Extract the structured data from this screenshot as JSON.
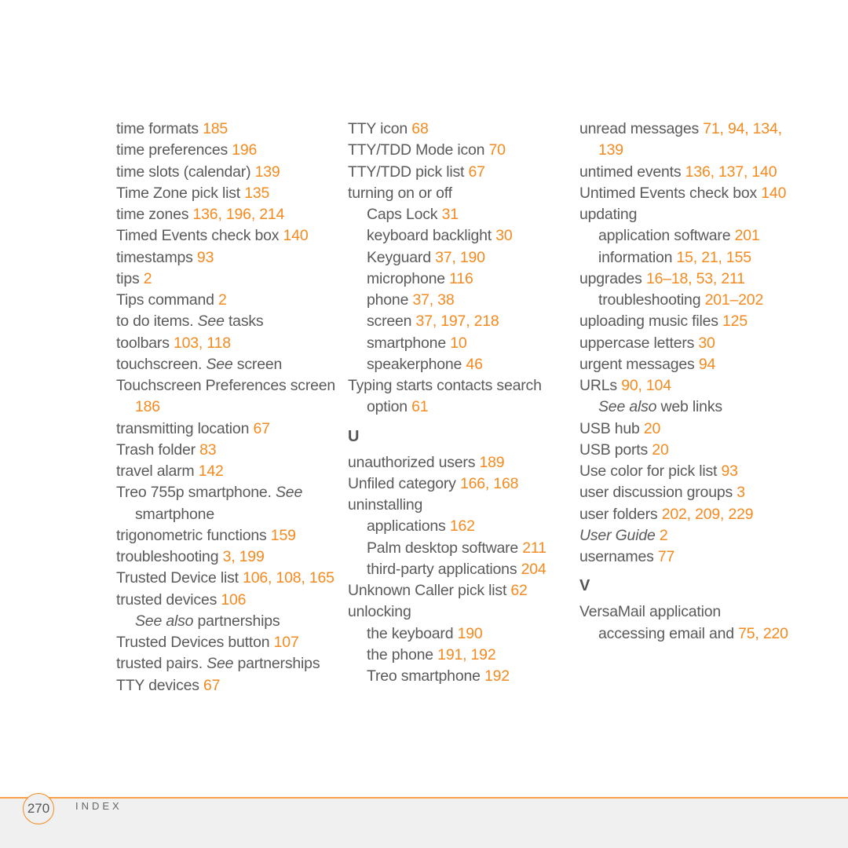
{
  "accent_color": "#f58a1f",
  "columns": [
    {
      "entries": [
        {
          "level": 0,
          "parts": [
            {
              "t": "time formats "
            },
            {
              "t": "185",
              "pg": true
            }
          ]
        },
        {
          "level": 0,
          "parts": [
            {
              "t": "time preferences "
            },
            {
              "t": "196",
              "pg": true
            }
          ]
        },
        {
          "level": 0,
          "parts": [
            {
              "t": "time slots (calendar) "
            },
            {
              "t": "139",
              "pg": true
            }
          ]
        },
        {
          "level": 0,
          "parts": [
            {
              "t": "Time Zone pick list "
            },
            {
              "t": "135",
              "pg": true
            }
          ]
        },
        {
          "level": 0,
          "parts": [
            {
              "t": "time zones "
            },
            {
              "t": "136, 196, 214",
              "pg": true
            }
          ]
        },
        {
          "level": 0,
          "parts": [
            {
              "t": "Timed Events check box "
            },
            {
              "t": "140",
              "pg": true
            }
          ]
        },
        {
          "level": 0,
          "parts": [
            {
              "t": "timestamps "
            },
            {
              "t": "93",
              "pg": true
            }
          ]
        },
        {
          "level": 0,
          "parts": [
            {
              "t": "tips "
            },
            {
              "t": "2",
              "pg": true
            }
          ]
        },
        {
          "level": 0,
          "parts": [
            {
              "t": "Tips command "
            },
            {
              "t": "2",
              "pg": true
            }
          ]
        },
        {
          "level": 0,
          "parts": [
            {
              "t": "to do items. "
            },
            {
              "t": "See",
              "it": true
            },
            {
              "t": " tasks"
            }
          ]
        },
        {
          "level": 0,
          "parts": [
            {
              "t": "toolbars "
            },
            {
              "t": "103, 118",
              "pg": true
            }
          ]
        },
        {
          "level": 0,
          "parts": [
            {
              "t": "touchscreen. "
            },
            {
              "t": "See",
              "it": true
            },
            {
              "t": " screen"
            }
          ]
        },
        {
          "level": 0,
          "parts": [
            {
              "t": "Touchscreen Preferences screen "
            },
            {
              "t": "186",
              "pg": true
            }
          ]
        },
        {
          "level": 0,
          "parts": [
            {
              "t": "transmitting location "
            },
            {
              "t": "67",
              "pg": true
            }
          ]
        },
        {
          "level": 0,
          "parts": [
            {
              "t": "Trash folder "
            },
            {
              "t": "83",
              "pg": true
            }
          ]
        },
        {
          "level": 0,
          "parts": [
            {
              "t": "travel alarm "
            },
            {
              "t": "142",
              "pg": true
            }
          ]
        },
        {
          "level": 0,
          "parts": [
            {
              "t": "Treo 755p smartphone. "
            },
            {
              "t": "See",
              "it": true
            },
            {
              "t": " smartphone"
            }
          ]
        },
        {
          "level": 0,
          "parts": [
            {
              "t": "trigonometric functions "
            },
            {
              "t": "159",
              "pg": true
            }
          ]
        },
        {
          "level": 0,
          "parts": [
            {
              "t": "troubleshooting "
            },
            {
              "t": "3, 199",
              "pg": true
            }
          ]
        },
        {
          "level": 0,
          "parts": [
            {
              "t": "Trusted Device list "
            },
            {
              "t": "106, 108, 165",
              "pg": true
            }
          ]
        },
        {
          "level": 0,
          "parts": [
            {
              "t": "trusted devices "
            },
            {
              "t": "106",
              "pg": true
            }
          ]
        },
        {
          "level": 1,
          "parts": [
            {
              "t": "See also",
              "it": true
            },
            {
              "t": " partnerships"
            }
          ]
        },
        {
          "level": 0,
          "parts": [
            {
              "t": "Trusted Devices button "
            },
            {
              "t": "107",
              "pg": true
            }
          ]
        },
        {
          "level": 0,
          "parts": [
            {
              "t": "trusted pairs. "
            },
            {
              "t": "See",
              "it": true
            },
            {
              "t": " partnerships"
            }
          ]
        },
        {
          "level": 0,
          "parts": [
            {
              "t": "TTY devices "
            },
            {
              "t": "67",
              "pg": true
            }
          ]
        }
      ]
    },
    {
      "entries": [
        {
          "level": 0,
          "parts": [
            {
              "t": "TTY icon "
            },
            {
              "t": "68",
              "pg": true
            }
          ]
        },
        {
          "level": 0,
          "parts": [
            {
              "t": "TTY/TDD Mode icon "
            },
            {
              "t": "70",
              "pg": true
            }
          ]
        },
        {
          "level": 0,
          "parts": [
            {
              "t": "TTY/TDD pick list "
            },
            {
              "t": "67",
              "pg": true
            }
          ]
        },
        {
          "level": 0,
          "parts": [
            {
              "t": "turning on or off"
            }
          ]
        },
        {
          "level": 1,
          "parts": [
            {
              "t": "Caps Lock "
            },
            {
              "t": "31",
              "pg": true
            }
          ]
        },
        {
          "level": 1,
          "parts": [
            {
              "t": "keyboard backlight "
            },
            {
              "t": "30",
              "pg": true
            }
          ]
        },
        {
          "level": 1,
          "parts": [
            {
              "t": "Keyguard "
            },
            {
              "t": "37, 190",
              "pg": true
            }
          ]
        },
        {
          "level": 1,
          "parts": [
            {
              "t": "microphone "
            },
            {
              "t": "116",
              "pg": true
            }
          ]
        },
        {
          "level": 1,
          "parts": [
            {
              "t": "phone "
            },
            {
              "t": "37, 38",
              "pg": true
            }
          ]
        },
        {
          "level": 1,
          "parts": [
            {
              "t": "screen "
            },
            {
              "t": "37, 197, 218",
              "pg": true
            }
          ]
        },
        {
          "level": 1,
          "parts": [
            {
              "t": "smartphone "
            },
            {
              "t": "10",
              "pg": true
            }
          ]
        },
        {
          "level": 1,
          "parts": [
            {
              "t": "speakerphone "
            },
            {
              "t": "46",
              "pg": true
            }
          ]
        },
        {
          "level": 0,
          "parts": [
            {
              "t": "Typing starts contacts search option "
            },
            {
              "t": "61",
              "pg": true
            }
          ]
        },
        {
          "letter": "U"
        },
        {
          "level": 0,
          "parts": [
            {
              "t": "unauthorized users "
            },
            {
              "t": "189",
              "pg": true
            }
          ]
        },
        {
          "level": 0,
          "parts": [
            {
              "t": "Unfiled category "
            },
            {
              "t": "166, 168",
              "pg": true
            }
          ]
        },
        {
          "level": 0,
          "parts": [
            {
              "t": "uninstalling"
            }
          ]
        },
        {
          "level": 1,
          "parts": [
            {
              "t": "applications "
            },
            {
              "t": "162",
              "pg": true
            }
          ]
        },
        {
          "level": 1,
          "parts": [
            {
              "t": "Palm desktop software "
            },
            {
              "t": "211",
              "pg": true
            }
          ]
        },
        {
          "level": 1,
          "parts": [
            {
              "t": "third-party applications "
            },
            {
              "t": "204",
              "pg": true
            }
          ]
        },
        {
          "level": 0,
          "parts": [
            {
              "t": "Unknown Caller pick list "
            },
            {
              "t": "62",
              "pg": true
            }
          ]
        },
        {
          "level": 0,
          "parts": [
            {
              "t": "unlocking"
            }
          ]
        },
        {
          "level": 1,
          "parts": [
            {
              "t": "the keyboard "
            },
            {
              "t": "190",
              "pg": true
            }
          ]
        },
        {
          "level": 1,
          "parts": [
            {
              "t": "the phone "
            },
            {
              "t": "191, 192",
              "pg": true
            }
          ]
        },
        {
          "level": 1,
          "parts": [
            {
              "t": "Treo smartphone "
            },
            {
              "t": "192",
              "pg": true
            }
          ]
        }
      ]
    },
    {
      "entries": [
        {
          "level": 0,
          "parts": [
            {
              "t": "unread messages "
            },
            {
              "t": "71, 94, 134, 139",
              "pg": true
            }
          ]
        },
        {
          "level": 0,
          "parts": [
            {
              "t": "untimed events "
            },
            {
              "t": "136, 137, 140",
              "pg": true
            }
          ]
        },
        {
          "level": 0,
          "parts": [
            {
              "t": "Untimed Events check box "
            },
            {
              "t": "140",
              "pg": true
            }
          ]
        },
        {
          "level": 0,
          "parts": [
            {
              "t": "updating"
            }
          ]
        },
        {
          "level": 1,
          "parts": [
            {
              "t": "application software "
            },
            {
              "t": "201",
              "pg": true
            }
          ]
        },
        {
          "level": 1,
          "parts": [
            {
              "t": "information "
            },
            {
              "t": "15, 21, 155",
              "pg": true
            }
          ]
        },
        {
          "level": 0,
          "parts": [
            {
              "t": "upgrades "
            },
            {
              "t": "16–18, 53, 211",
              "pg": true
            }
          ]
        },
        {
          "level": 1,
          "parts": [
            {
              "t": "troubleshooting "
            },
            {
              "t": "201–202",
              "pg": true
            }
          ]
        },
        {
          "level": 0,
          "parts": [
            {
              "t": "uploading music files "
            },
            {
              "t": "125",
              "pg": true
            }
          ]
        },
        {
          "level": 0,
          "parts": [
            {
              "t": "uppercase letters "
            },
            {
              "t": "30",
              "pg": true
            }
          ]
        },
        {
          "level": 0,
          "parts": [
            {
              "t": "urgent messages "
            },
            {
              "t": "94",
              "pg": true
            }
          ]
        },
        {
          "level": 0,
          "parts": [
            {
              "t": "URLs "
            },
            {
              "t": "90, 104",
              "pg": true
            }
          ]
        },
        {
          "level": 1,
          "parts": [
            {
              "t": "See also",
              "it": true
            },
            {
              "t": " web links"
            }
          ]
        },
        {
          "level": 0,
          "parts": [
            {
              "t": "USB hub "
            },
            {
              "t": "20",
              "pg": true
            }
          ]
        },
        {
          "level": 0,
          "parts": [
            {
              "t": "USB ports "
            },
            {
              "t": "20",
              "pg": true
            }
          ]
        },
        {
          "level": 0,
          "parts": [
            {
              "t": "Use color for pick list "
            },
            {
              "t": "93",
              "pg": true
            }
          ]
        },
        {
          "level": 0,
          "parts": [
            {
              "t": "user discussion groups "
            },
            {
              "t": "3",
              "pg": true
            }
          ]
        },
        {
          "level": 0,
          "parts": [
            {
              "t": "user folders "
            },
            {
              "t": "202, 209, 229",
              "pg": true
            }
          ]
        },
        {
          "level": 0,
          "parts": [
            {
              "t": "User Guide",
              "it": true
            },
            {
              "t": " "
            },
            {
              "t": "2",
              "pg": true
            }
          ]
        },
        {
          "level": 0,
          "parts": [
            {
              "t": "usernames "
            },
            {
              "t": "77",
              "pg": true
            }
          ]
        },
        {
          "letter": "V"
        },
        {
          "level": 0,
          "parts": [
            {
              "t": "VersaMail application"
            }
          ]
        },
        {
          "level": 1,
          "parts": [
            {
              "t": "accessing email and "
            },
            {
              "t": "75, 220",
              "pg": true
            }
          ]
        }
      ]
    }
  ],
  "footer": {
    "page_number": "270",
    "section": "INDEX"
  }
}
